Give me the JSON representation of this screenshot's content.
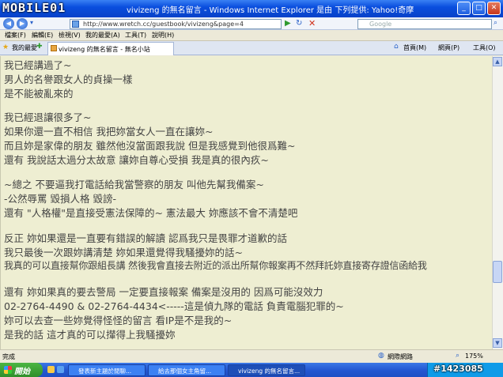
{
  "window": {
    "title": "vivizeng 的無名留言 - Windows Internet Explorer 是由 下列提供: Yahoo!奇摩",
    "logo": "MOBILE01"
  },
  "address": {
    "url": "http://www.wretch.cc/guestbook/vivizeng&page=4",
    "search_placeholder": "Google"
  },
  "menu": [
    "檔案(F)",
    "編輯(E)",
    "檢視(V)",
    "我的最愛(A)",
    "工具(T)",
    "說明(H)"
  ],
  "tabs": {
    "favorites": "我的最愛",
    "active_tab": "vivizeng 的無名留言 - 無名小站"
  },
  "toolbar_right": {
    "home": "首頁(M)",
    "page": "網頁(P)",
    "tools": "工具(O)"
  },
  "content_lines": [
    "我已經講過了~",
    "男人的名譽跟女人的貞操一樣",
    "是不能被亂來的",
    "",
    "我已經退讓很多了~",
    "如果你還一直不相信 我把妳當女人一直在讓妳~",
    "而且妳是家偉的朋友 雖然他沒當面跟我說 但是我感覺到他很爲難~",
    "還有 我說話太過分太故意 讓妳自尊心受損 我是真的很內疚~",
    "",
    "~總之 不要逼我打電話給我當警察的朋友 叫他先幫我備案~",
    "-公然辱罵 毀損人格 毀謗-",
    "還有 \"人格權\"是直接受憲法保障的~ 憲法最大 妳應該不會不清楚吧",
    "",
    "反正 妳如果還是一直要有錯誤的解讀 認爲我只是畏罪才道歉的話",
    "我只最後一次跟妳講清楚 妳如果還覺得我騷擾妳的話~",
    "我真的可以直接幫你跟組長講 然後我會直接去附近的派出所幫你報案再不然拜託妳直接寄存證信函給我",
    "",
    "還有 妳如果真的要去警局 一定要直接報案 備案是沒用的 因爲可能沒效力",
    "02-2764-4490 & 02-2764-4434<-----這是偵九隊的電話 負責電腦犯罪的~",
    "妳可以去查一些妳覺得怪怪的留言 看IP是不是我的~",
    "是我的話 這才真的可以攆得上我騷擾妳"
  ],
  "status": {
    "text": "完成",
    "zone": "網際網路",
    "zoom": "175%"
  },
  "taskbar": {
    "start": "開始",
    "tasks": [
      "發表新主題於閒聊...",
      "給去那個女主角留...",
      "vivizeng 的無名留言..."
    ],
    "watermark": "#1423085"
  }
}
